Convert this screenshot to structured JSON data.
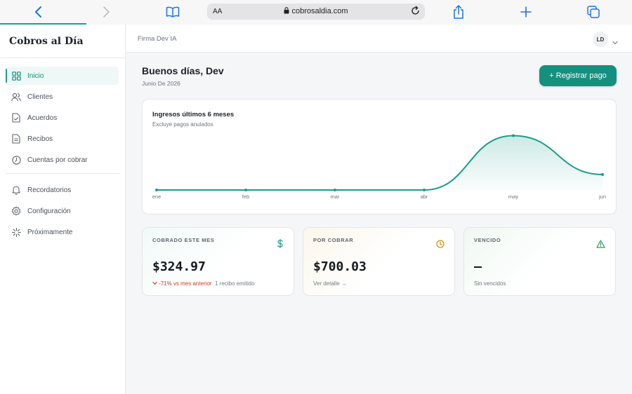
{
  "browser": {
    "url": "cobrosaldia.com",
    "reader_label": "AA"
  },
  "app": {
    "brand": "Cobros al Día"
  },
  "sidebar": {
    "items": [
      {
        "label": "Inicio",
        "icon": "grid-icon"
      },
      {
        "label": "Clientes",
        "icon": "users-icon"
      },
      {
        "label": "Acuerdos",
        "icon": "file-check-icon"
      },
      {
        "label": "Recibos",
        "icon": "receipt-icon"
      },
      {
        "label": "Cuentas por cobrar",
        "icon": "clock-icon"
      }
    ],
    "items_secondary": [
      {
        "label": "Recordatorios",
        "icon": "bell-icon"
      },
      {
        "label": "Configuración",
        "icon": "gear-icon"
      },
      {
        "label": "Próximamente",
        "icon": "sparkle-icon"
      }
    ]
  },
  "header": {
    "org": "Firma Dev IA",
    "avatar_initials": "LD"
  },
  "main": {
    "greeting": "Buenos días, Dev",
    "date": "Junio De 2026",
    "cta": "+ Registrar pago"
  },
  "chart_data": {
    "type": "area",
    "title": "Ingresos últimos 6 meses",
    "subtitle": "Excluye pagos anulados",
    "categories": [
      "ene",
      "feb",
      "mar",
      "abr",
      "may",
      "jun"
    ],
    "series": [
      {
        "values": [
          0,
          0,
          0,
          0,
          1140,
          324.97
        ]
      }
    ],
    "ylim": [
      0,
      1250
    ],
    "grid": false,
    "color": "#1a9c8a"
  },
  "stats": [
    {
      "label": "COBRADO ESTE MES",
      "value": "$324.97",
      "delta": "-71% vs mes anterior",
      "note": "1 recibo emitido",
      "icon": "dollar-icon",
      "color": "#1a9c8a"
    },
    {
      "label": "POR COBRAR",
      "value": "$700.03",
      "note": "Ver detalle →",
      "icon": "clock-icon",
      "color": "#d98b0b"
    },
    {
      "label": "VENCIDO",
      "value": "",
      "note": "Sin vencidos",
      "icon": "warning-icon",
      "color": "#2f9a55"
    }
  ]
}
